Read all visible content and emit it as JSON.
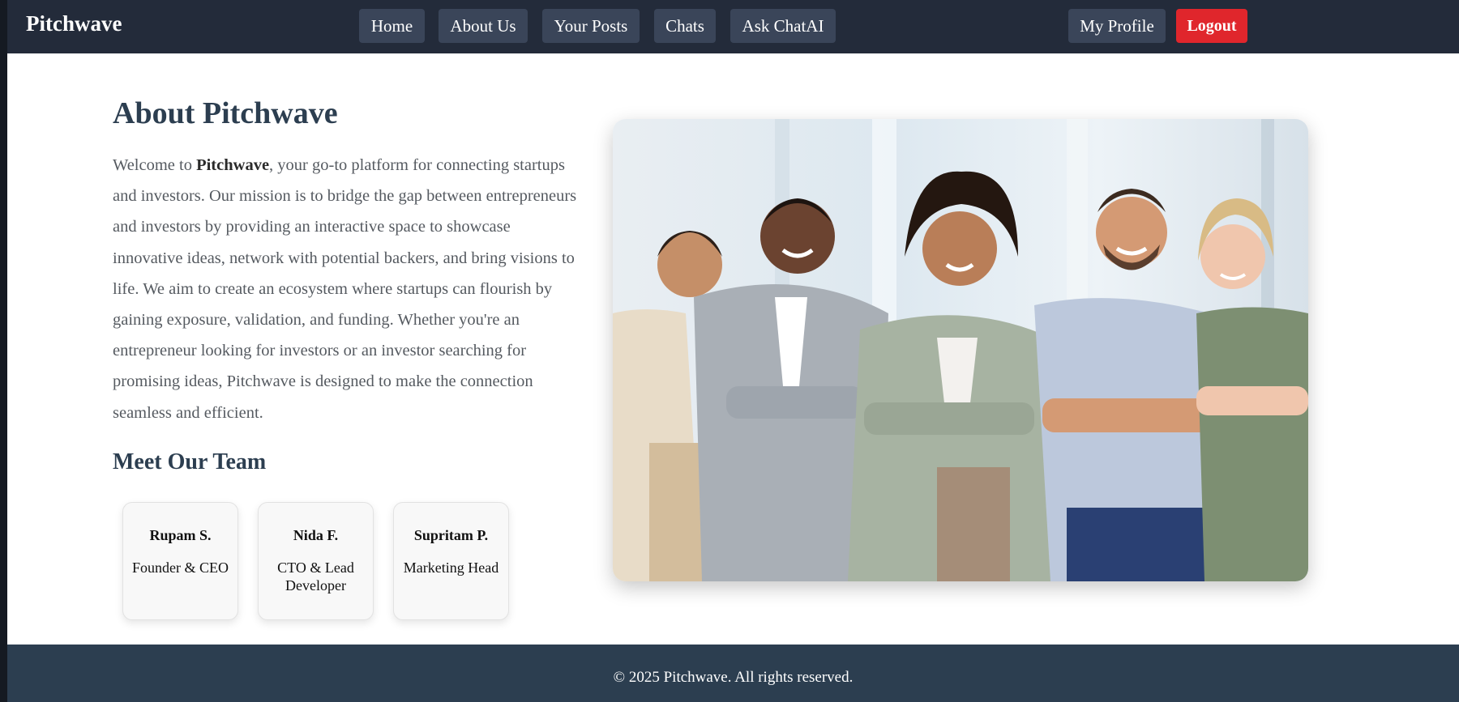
{
  "navbar": {
    "brand": "Pitchwave",
    "links": [
      "Home",
      "About Us",
      "Your Posts",
      "Chats",
      "Ask ChatAI"
    ],
    "profile_label": "My Profile",
    "logout_label": "Logout",
    "logout_color": "#e0262c",
    "background_color": "#232b3a"
  },
  "about": {
    "title": "About Pitchwave",
    "intro_prefix": "Welcome to ",
    "intro_brand": "Pitchwave",
    "intro_rest": ", your go-to platform for connecting startups and investors. Our mission is to bridge the gap between entrepreneurs and investors by providing an interactive space to showcase innovative ideas, network with potential backers, and bring visions to life. We aim to create an ecosystem where startups can flourish by gaining exposure, validation, and funding. Whether you're an entrepreneur looking for investors or an investor searching for promising ideas, Pitchwave is designed to make the connection seamless and efficient."
  },
  "team": {
    "title": "Meet Our Team",
    "members": [
      {
        "name": "Rupam S.",
        "role": "Founder & CEO"
      },
      {
        "name": "Nida F.",
        "role": "CTO & Lead Developer"
      },
      {
        "name": "Supritam P.",
        "role": "Marketing Head"
      }
    ]
  },
  "hero": {
    "image_subject": "team-group-photo"
  },
  "footer": {
    "text": "© 2025 Pitchwave. All rights reserved.",
    "background_color": "#2c3e50"
  }
}
